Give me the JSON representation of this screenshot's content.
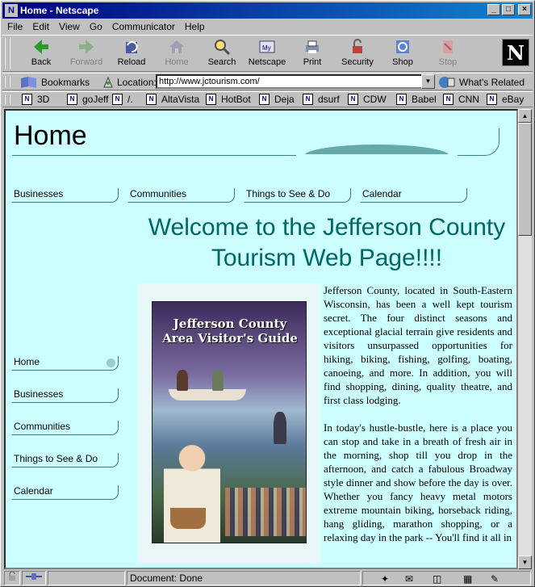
{
  "window": {
    "title": "Home - Netscape"
  },
  "menu": [
    "File",
    "Edit",
    "View",
    "Go",
    "Communicator",
    "Help"
  ],
  "toolbar": {
    "back": "Back",
    "forward": "Forward",
    "reload": "Reload",
    "home": "Home",
    "search": "Search",
    "netscape": "Netscape",
    "print": "Print",
    "security": "Security",
    "shop": "Shop",
    "stop": "Stop"
  },
  "location": {
    "bookmarks_label": "Bookmarks",
    "location_label": "Location:",
    "url": "http://www.jctourism.com/",
    "related_label": "What's Related"
  },
  "personal_toolbar": [
    "3D",
    "goJeff",
    "/.",
    "AltaVista",
    "HotBot",
    "Deja",
    "dsurf",
    "CDW",
    "Babel",
    "CNN",
    "eBay"
  ],
  "page": {
    "title": "Home",
    "top_nav": [
      "Businesses",
      "Communities",
      "Things to See & Do",
      "Calendar"
    ],
    "welcome": "Welcome to the Jefferson County Tourism Web Page!!!!",
    "side_nav": [
      "Home",
      "Businesses",
      "Communities",
      "Things to See & Do",
      "Calendar"
    ],
    "guide_title": "Jefferson County Area Visitor's Guide",
    "paragraph1": "Jefferson County, located in South-Eastern Wisconsin, has been a well kept tourism secret. The four distinct seasons and exceptional glacial terrain give residents and visitors unsurpassed opportunities for hiking, biking, fishing, golfing, boating, canoeing, and more. In addition, you will find shopping, dining, quality theatre, and first class lodging.",
    "paragraph2": "In today's hustle-bustle, here is a place you can stop and take in a breath of fresh air in the morning, shop till you drop in the afternoon, and catch a fabulous Broadway style dinner and show before the day is over. Whether you fancy heavy metal motors extreme mountain biking, horseback riding, hang gliding, marathon shopping, or a relaxing day in the park -- You'll find it all in"
  },
  "status": {
    "text": "Document: Done"
  },
  "colors": {
    "page_background": "#ccffff",
    "heading_teal": "#006666",
    "title_bar": "#000080"
  }
}
